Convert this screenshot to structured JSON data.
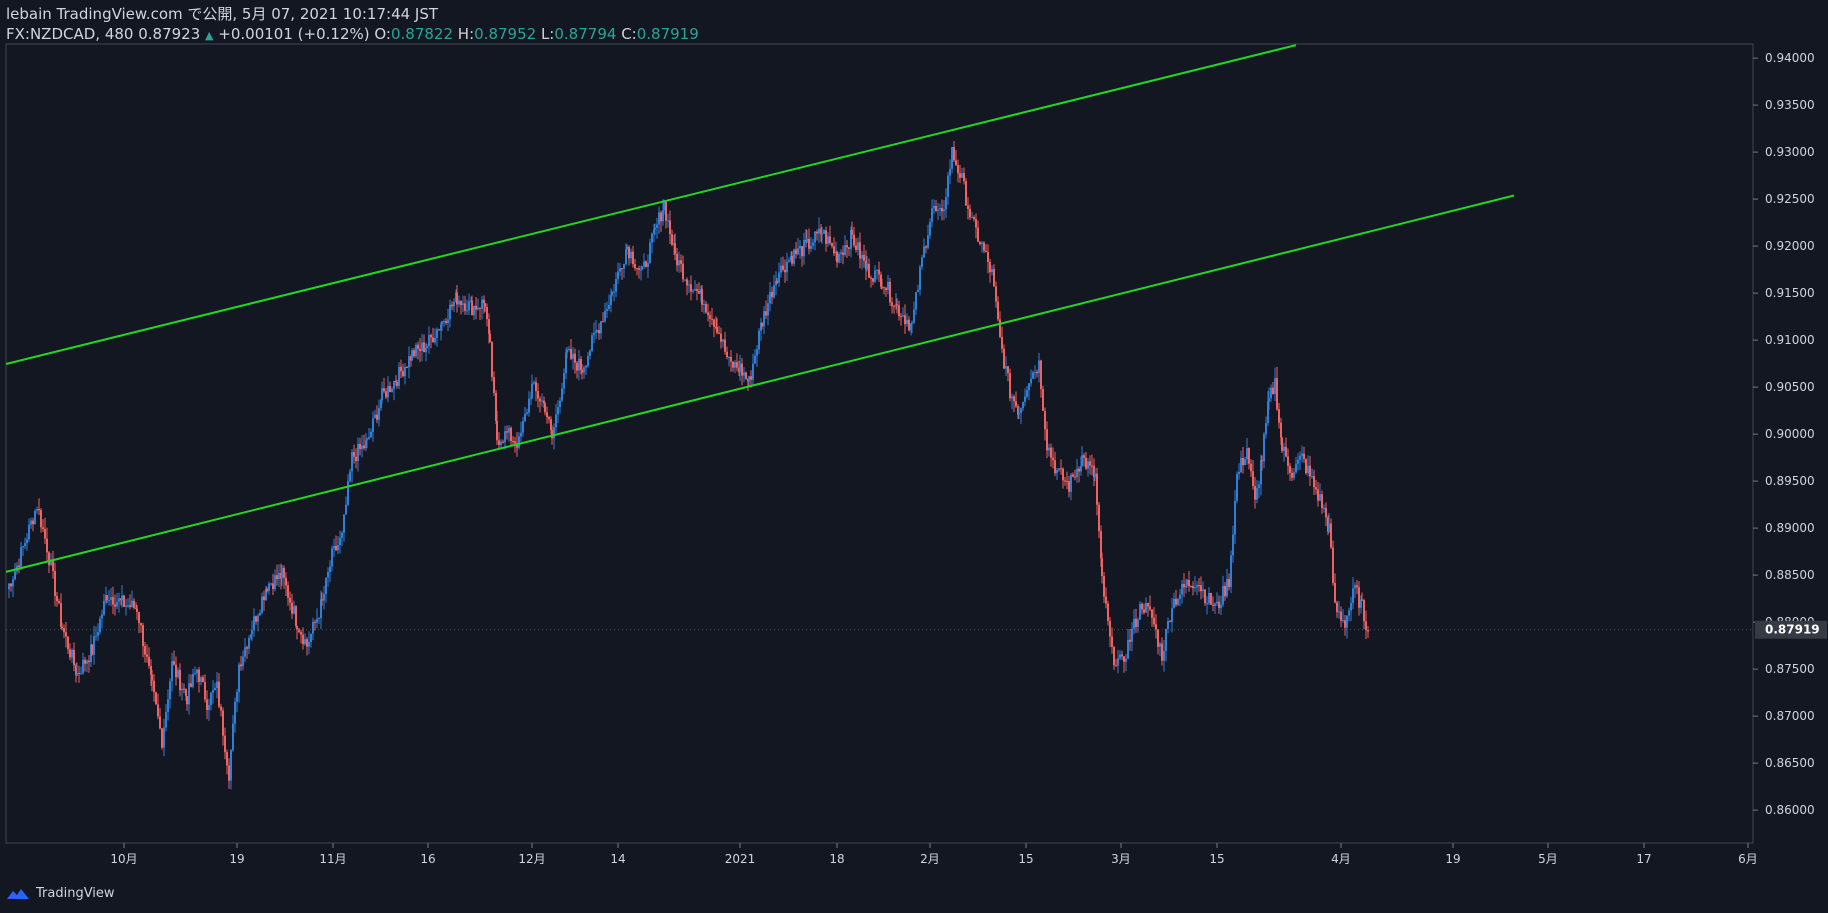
{
  "header": {
    "line1": "lebain TradingView.com で公開, 5月 07, 2021 10:17:44 JST",
    "symbol_part": "FX:NZDCAD, 480 0.87923",
    "up_arrow": "▲",
    "change_part": "+0.00101 (+0.12%)",
    "o_label": "O:",
    "o_value": "0.87822",
    "h_label": "H:",
    "h_value": "0.87952",
    "l_label": "L:",
    "l_value": "0.87794",
    "c_label": "C:",
    "c_value": "0.87919"
  },
  "footer": {
    "brand": "TradingView",
    "logo_icon": "tradingview-logo-icon"
  },
  "colors": {
    "background": "#131722",
    "up": "#2f7fd8",
    "down": "#f0625f",
    "channel": "#22d622",
    "axis_text": "#d1d4dc",
    "price_tag_bg": "#363a45"
  },
  "chart_data": {
    "type": "candlestick",
    "symbol": "FX:NZDCAD",
    "interval": "480",
    "ylim": [
      0.8565,
      0.9415
    ],
    "y_ticks": [
      "0.86000",
      "0.86500",
      "0.87000",
      "0.87500",
      "0.88000",
      "0.88500",
      "0.89000",
      "0.89500",
      "0.90000",
      "0.90500",
      "0.91000",
      "0.91500",
      "0.92000",
      "0.92500",
      "0.93000",
      "0.93500",
      "0.94000"
    ],
    "x_ticks": [
      "10月",
      "19",
      "11月",
      "16",
      "12月",
      "14",
      "2021",
      "18",
      "2月",
      "15",
      "3月",
      "15",
      "4月",
      "19",
      "5月",
      "17",
      "6月"
    ],
    "last_price": "0.87919",
    "close_series": [
      [
        0,
        0.8835
      ],
      [
        10,
        0.886
      ],
      [
        20,
        0.8892
      ],
      [
        30,
        0.8925
      ],
      [
        40,
        0.888
      ],
      [
        55,
        0.8795
      ],
      [
        70,
        0.8745
      ],
      [
        85,
        0.877
      ],
      [
        100,
        0.883
      ],
      [
        115,
        0.882
      ],
      [
        130,
        0.8815
      ],
      [
        145,
        0.873
      ],
      [
        155,
        0.8675
      ],
      [
        165,
        0.8755
      ],
      [
        180,
        0.872
      ],
      [
        190,
        0.875
      ],
      [
        200,
        0.8715
      ],
      [
        210,
        0.873
      ],
      [
        222,
        0.864
      ],
      [
        232,
        0.8755
      ],
      [
        245,
        0.8795
      ],
      [
        260,
        0.884
      ],
      [
        275,
        0.885
      ],
      [
        290,
        0.88
      ],
      [
        300,
        0.8775
      ],
      [
        315,
        0.882
      ],
      [
        325,
        0.887
      ],
      [
        335,
        0.889
      ],
      [
        345,
        0.8975
      ],
      [
        360,
        0.899
      ],
      [
        375,
        0.904
      ],
      [
        390,
        0.906
      ],
      [
        405,
        0.9085
      ],
      [
        420,
        0.9095
      ],
      [
        435,
        0.912
      ],
      [
        450,
        0.9145
      ],
      [
        465,
        0.9135
      ],
      [
        478,
        0.914
      ],
      [
        483,
        0.909
      ],
      [
        490,
        0.8995
      ],
      [
        500,
        0.9
      ],
      [
        512,
        0.899
      ],
      [
        525,
        0.905
      ],
      [
        538,
        0.903
      ],
      [
        545,
        0.8995
      ],
      [
        560,
        0.9085
      ],
      [
        575,
        0.907
      ],
      [
        590,
        0.911
      ],
      [
        605,
        0.915
      ],
      [
        620,
        0.92
      ],
      [
        635,
        0.917
      ],
      [
        648,
        0.9215
      ],
      [
        657,
        0.9245
      ],
      [
        668,
        0.919
      ],
      [
        680,
        0.9165
      ],
      [
        695,
        0.9145
      ],
      [
        710,
        0.9115
      ],
      [
        722,
        0.9075
      ],
      [
        733,
        0.907
      ],
      [
        742,
        0.9055
      ],
      [
        755,
        0.912
      ],
      [
        770,
        0.917
      ],
      [
        785,
        0.919
      ],
      [
        800,
        0.92
      ],
      [
        815,
        0.9215
      ],
      [
        830,
        0.919
      ],
      [
        845,
        0.921
      ],
      [
        860,
        0.9175
      ],
      [
        875,
        0.9165
      ],
      [
        890,
        0.9135
      ],
      [
        905,
        0.9115
      ],
      [
        915,
        0.9185
      ],
      [
        925,
        0.924
      ],
      [
        935,
        0.923
      ],
      [
        945,
        0.93
      ],
      [
        955,
        0.927
      ],
      [
        965,
        0.9225
      ],
      [
        975,
        0.92
      ],
      [
        985,
        0.917
      ],
      [
        993,
        0.91
      ],
      [
        1003,
        0.9045
      ],
      [
        1012,
        0.9025
      ],
      [
        1022,
        0.906
      ],
      [
        1032,
        0.9075
      ],
      [
        1040,
        0.899
      ],
      [
        1050,
        0.896
      ],
      [
        1062,
        0.8945
      ],
      [
        1075,
        0.8975
      ],
      [
        1088,
        0.8955
      ],
      [
        1095,
        0.8845
      ],
      [
        1105,
        0.8765
      ],
      [
        1115,
        0.8755
      ],
      [
        1125,
        0.879
      ],
      [
        1135,
        0.882
      ],
      [
        1145,
        0.8805
      ],
      [
        1155,
        0.8765
      ],
      [
        1165,
        0.882
      ],
      [
        1180,
        0.884
      ],
      [
        1190,
        0.8845
      ],
      [
        1200,
        0.8825
      ],
      [
        1210,
        0.8815
      ],
      [
        1222,
        0.8845
      ],
      [
        1230,
        0.8955
      ],
      [
        1240,
        0.8985
      ],
      [
        1248,
        0.8925
      ],
      [
        1255,
        0.8975
      ],
      [
        1262,
        0.9035
      ],
      [
        1268,
        0.9055
      ],
      [
        1275,
        0.8985
      ],
      [
        1285,
        0.896
      ],
      [
        1295,
        0.8975
      ],
      [
        1305,
        0.895
      ],
      [
        1315,
        0.8925
      ],
      [
        1322,
        0.89
      ],
      [
        1328,
        0.8815
      ],
      [
        1338,
        0.88
      ],
      [
        1348,
        0.8835
      ],
      [
        1355,
        0.8815
      ],
      [
        1361,
        0.879
      ]
    ],
    "channel_lines": [
      {
        "name": "upper",
        "x": [
          0,
          1290
        ],
        "y": [
          0.90746,
          0.94138
        ]
      },
      {
        "name": "lower",
        "x": [
          0,
          1508
        ],
        "y": [
          0.88534,
          0.92538
        ]
      }
    ]
  }
}
